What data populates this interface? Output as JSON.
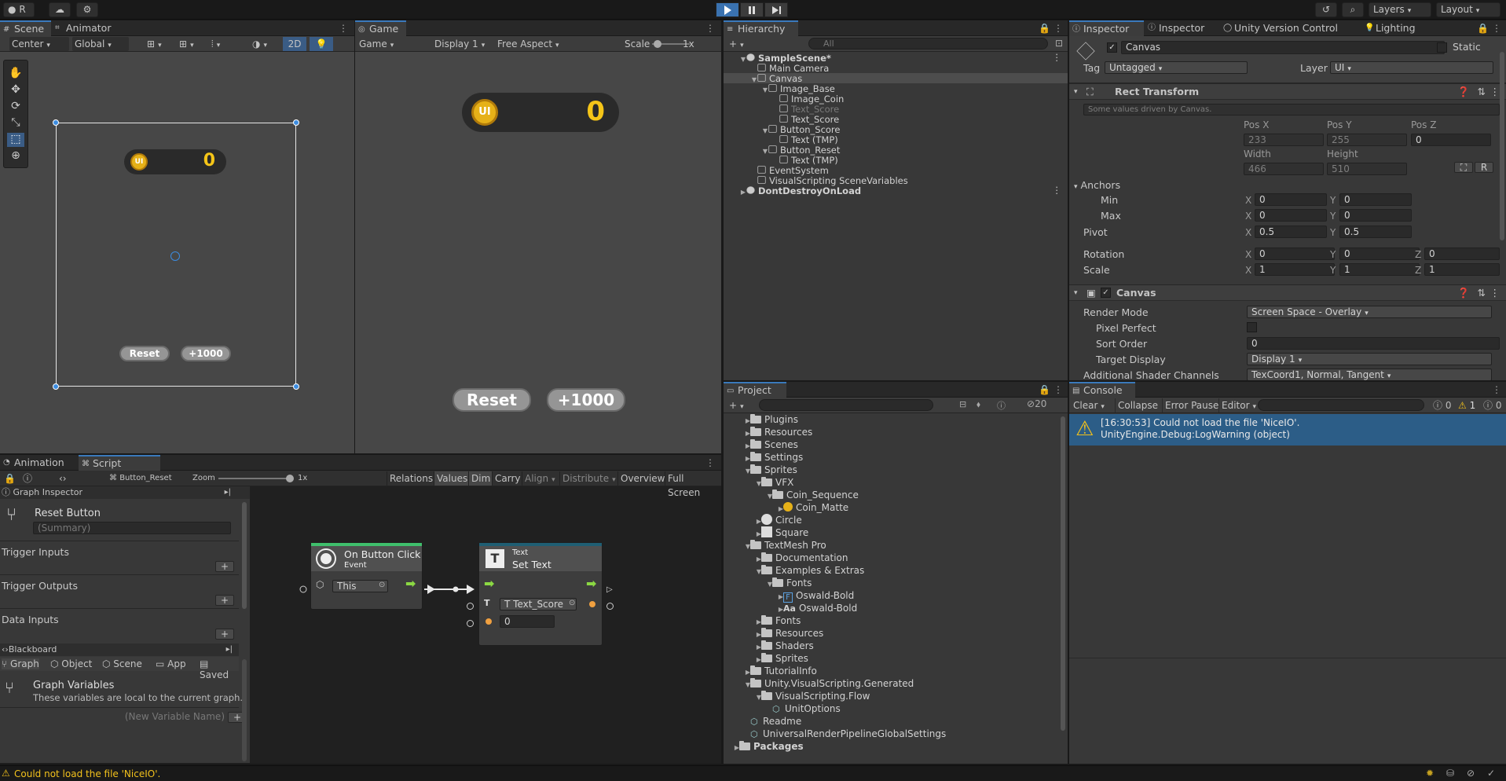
{
  "toolbar": {
    "account": "R",
    "layers": "Layers",
    "layout": "Layout"
  },
  "scene": {
    "tabs": [
      "Scene",
      "Animator"
    ],
    "pivot": "Center",
    "space": "Global",
    "mode2d": "2D",
    "reset": "Reset",
    "plus": "+1000",
    "coin_value": "0",
    "coin_glyph": "UI"
  },
  "game": {
    "tab": "Game",
    "view": "Game",
    "display": "Display 1",
    "aspect": "Free Aspect",
    "scale_label": "Scale",
    "scale_value": "1x",
    "reset": "Reset",
    "plus": "+1000",
    "coin_value": "0"
  },
  "hierarchy": {
    "tab": "Hierarchy",
    "search_placeholder": "All",
    "items": [
      {
        "label": "SampleScene*",
        "depth": 0,
        "kind": "scene",
        "exp": "down"
      },
      {
        "label": "Main Camera",
        "depth": 1,
        "kind": "go",
        "exp": ""
      },
      {
        "label": "Canvas",
        "depth": 1,
        "kind": "go",
        "exp": "down",
        "selected": true
      },
      {
        "label": "Image_Base",
        "depth": 2,
        "kind": "go",
        "exp": "down"
      },
      {
        "label": "Image_Coin",
        "depth": 3,
        "kind": "go",
        "exp": ""
      },
      {
        "label": "Text_Score",
        "depth": 3,
        "kind": "go",
        "exp": "",
        "dim": true
      },
      {
        "label": "Text_Score",
        "depth": 3,
        "kind": "go",
        "exp": ""
      },
      {
        "label": "Button_Score",
        "depth": 2,
        "kind": "go",
        "exp": "down"
      },
      {
        "label": "Text (TMP)",
        "depth": 3,
        "kind": "go",
        "exp": ""
      },
      {
        "label": "Button_Reset",
        "depth": 2,
        "kind": "go",
        "exp": "down"
      },
      {
        "label": "Text (TMP)",
        "depth": 3,
        "kind": "go",
        "exp": ""
      },
      {
        "label": "EventSystem",
        "depth": 1,
        "kind": "go",
        "exp": ""
      },
      {
        "label": "VisualScripting SceneVariables",
        "depth": 1,
        "kind": "go",
        "exp": ""
      },
      {
        "label": "DontDestroyOnLoad",
        "depth": 0,
        "kind": "scene",
        "exp": "right"
      }
    ]
  },
  "inspector": {
    "tabs": [
      "Inspector",
      "Inspector",
      "Unity Version Control",
      "Lighting"
    ],
    "name": "Canvas",
    "static": "Static",
    "tag_label": "Tag",
    "tag": "Untagged",
    "layer_label": "Layer",
    "layer": "UI",
    "rect_title": "Rect Transform",
    "driven_note": "Some values driven by Canvas.",
    "posx_label": "Pos X",
    "posy_label": "Pos Y",
    "posz_label": "Pos Z",
    "posx": "233",
    "posy": "255",
    "posz": "0",
    "width_label": "Width",
    "height_label": "Height",
    "width": "466",
    "height": "510",
    "anchors": "Anchors",
    "min": "Min",
    "max": "Max",
    "pivot": "Pivot",
    "rotation": "Rotation",
    "scale": "Scale",
    "min_x": "0",
    "min_y": "0",
    "max_x": "0",
    "max_y": "0",
    "pivot_x": "0.5",
    "pivot_y": "0.5",
    "rot_x": "0",
    "rot_y": "0",
    "rot_z": "0",
    "scale_x": "1",
    "scale_y": "1",
    "scale_z": "1",
    "r_btn": "R",
    "canvas_title": "Canvas",
    "render_mode_label": "Render Mode",
    "render_mode": "Screen Space - Overlay",
    "pixel_perfect": "Pixel Perfect",
    "sort_order_label": "Sort Order",
    "sort_order": "0",
    "target_display_label": "Target Display",
    "target_display": "Display 1",
    "shader_label": "Additional Shader Channels",
    "shader": "TexCoord1, Normal, Tangent",
    "axes": [
      "X",
      "Y",
      "Z"
    ]
  },
  "project": {
    "tab": "Project",
    "hidden_count": "20",
    "items": [
      {
        "label": "Plugins",
        "depth": 1,
        "kind": "folder",
        "exp": "right"
      },
      {
        "label": "Resources",
        "depth": 1,
        "kind": "folder",
        "exp": "right"
      },
      {
        "label": "Scenes",
        "depth": 1,
        "kind": "folder",
        "exp": "right"
      },
      {
        "label": "Settings",
        "depth": 1,
        "kind": "folder",
        "exp": "right"
      },
      {
        "label": "Sprites",
        "depth": 1,
        "kind": "folder",
        "exp": "down"
      },
      {
        "label": "VFX",
        "depth": 2,
        "kind": "folder",
        "exp": "down"
      },
      {
        "label": "Coin_Sequence",
        "depth": 3,
        "kind": "folder",
        "exp": "down"
      },
      {
        "label": "Coin_Matte",
        "depth": 4,
        "kind": "coin",
        "exp": "right"
      },
      {
        "label": "Circle",
        "depth": 2,
        "kind": "circle",
        "exp": "right"
      },
      {
        "label": "Square",
        "depth": 2,
        "kind": "square",
        "exp": "right"
      },
      {
        "label": "TextMesh Pro",
        "depth": 1,
        "kind": "folder",
        "exp": "down"
      },
      {
        "label": "Documentation",
        "depth": 2,
        "kind": "folder",
        "exp": "right"
      },
      {
        "label": "Examples & Extras",
        "depth": 2,
        "kind": "folder",
        "exp": "down"
      },
      {
        "label": "Fonts",
        "depth": 3,
        "kind": "folder",
        "exp": "down"
      },
      {
        "label": "Oswald-Bold",
        "depth": 4,
        "kind": "fontF",
        "exp": "right"
      },
      {
        "label": "Oswald-Bold",
        "depth": 4,
        "kind": "fontAa",
        "exp": "right"
      },
      {
        "label": "Fonts",
        "depth": 2,
        "kind": "folder",
        "exp": "right"
      },
      {
        "label": "Resources",
        "depth": 2,
        "kind": "folder",
        "exp": "right"
      },
      {
        "label": "Shaders",
        "depth": 2,
        "kind": "folder",
        "exp": "right"
      },
      {
        "label": "Sprites",
        "depth": 2,
        "kind": "folder",
        "exp": "right"
      },
      {
        "label": "TutorialInfo",
        "depth": 1,
        "kind": "folder",
        "exp": "right"
      },
      {
        "label": "Unity.VisualScripting.Generated",
        "depth": 1,
        "kind": "folder",
        "exp": "down"
      },
      {
        "label": "VisualScripting.Flow",
        "depth": 2,
        "kind": "folder",
        "exp": "down"
      },
      {
        "label": "UnitOptions",
        "depth": 3,
        "kind": "asset",
        "exp": ""
      },
      {
        "label": "Readme",
        "depth": 1,
        "kind": "asset",
        "exp": ""
      },
      {
        "label": "UniversalRenderPipelineGlobalSettings",
        "depth": 1,
        "kind": "asset",
        "exp": ""
      },
      {
        "label": "Packages",
        "depth": 0,
        "kind": "folder",
        "exp": "right"
      }
    ]
  },
  "console": {
    "tab": "Console",
    "clear": "Clear",
    "collapse": "Collapse",
    "error_pause": "Error Pause",
    "editor": "Editor",
    "count_info": "0",
    "count_warn": "1",
    "count_err": "0",
    "msg1": "[16:30:53] Could not load the file 'NiceIO'.",
    "msg2": "UnityEngine.Debug:LogWarning (object)"
  },
  "bottom": {
    "tabs": [
      "Animation",
      "Script Graph"
    ],
    "graph_name": "Button_Reset",
    "zoom_label": "Zoom",
    "zoom_value": "1x",
    "toolbar": [
      "Relations",
      "Values",
      "Dim",
      "Carry",
      "Align",
      "Distribute",
      "Overview",
      "Full Screen"
    ]
  },
  "graph_inspector": {
    "title": "Graph Inspector",
    "name": "Reset Button",
    "summary_placeholder": "(Summary)",
    "trigger_inputs": "Trigger Inputs",
    "trigger_outputs": "Trigger Outputs",
    "data_inputs": "Data Inputs",
    "blackboard": "Blackboard",
    "bb_tabs": [
      "Graph",
      "Object",
      "Scene",
      "App",
      "Saved"
    ],
    "vars_title": "Graph Variables",
    "vars_desc": "These variables are local to the current graph.",
    "new_var_placeholder": "(New Variable Name)"
  },
  "nodes": {
    "event_title": "On Button Click",
    "event_sub": "Event",
    "event_this": "This",
    "set_small": "Text",
    "set_title": "Set Text",
    "set_field": "Text_Score",
    "set_value": "0"
  },
  "status": {
    "message": "Could not load the file 'NiceIO'."
  }
}
